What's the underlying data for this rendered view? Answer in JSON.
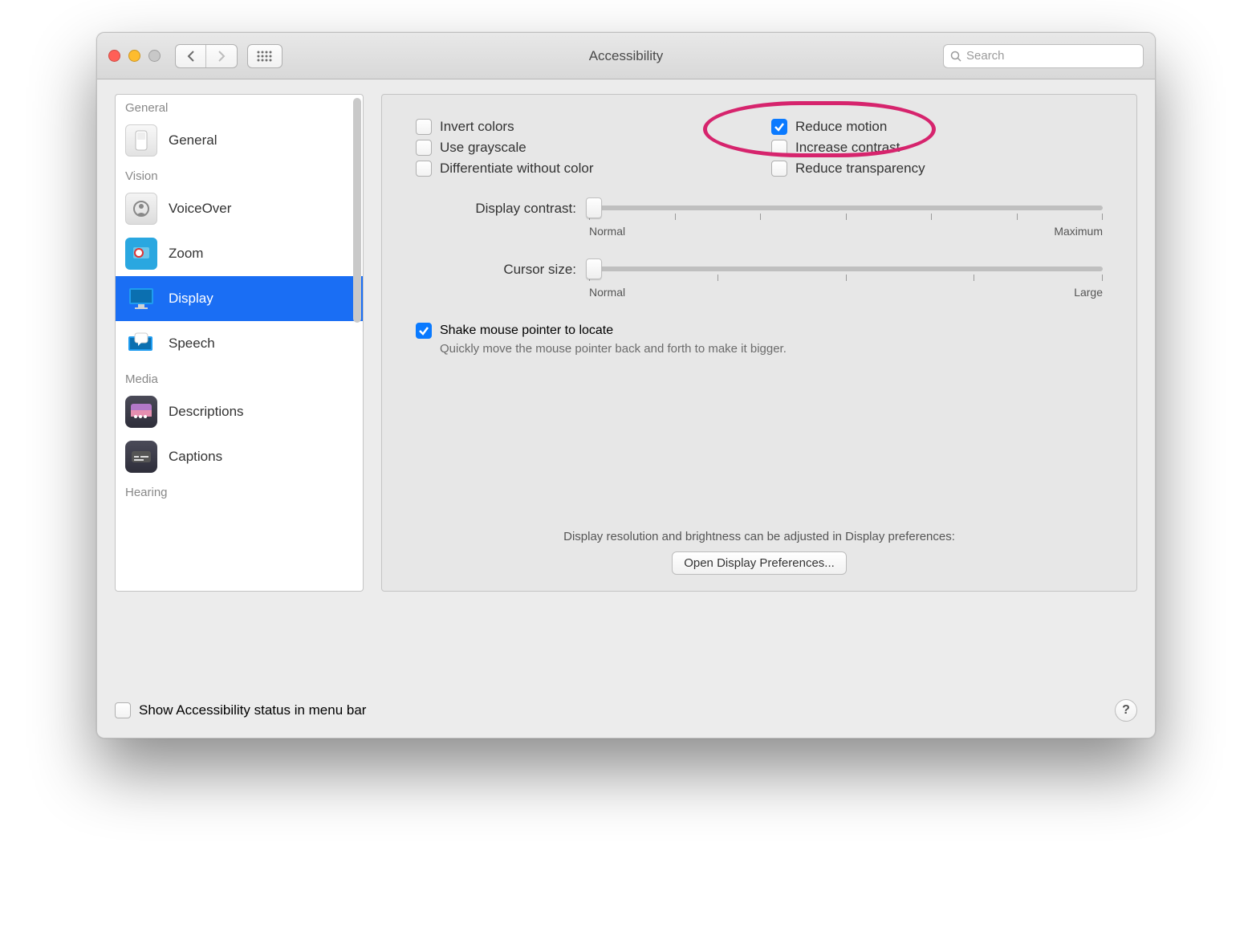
{
  "window": {
    "title": "Accessibility"
  },
  "search": {
    "placeholder": "Search"
  },
  "sidebar": {
    "sections": [
      {
        "header": "General",
        "items": [
          {
            "label": "General"
          }
        ]
      },
      {
        "header": "Vision",
        "items": [
          {
            "label": "VoiceOver"
          },
          {
            "label": "Zoom"
          },
          {
            "label": "Display"
          },
          {
            "label": "Speech"
          }
        ]
      },
      {
        "header": "Media",
        "items": [
          {
            "label": "Descriptions"
          },
          {
            "label": "Captions"
          }
        ]
      },
      {
        "header": "Hearing",
        "items": []
      }
    ]
  },
  "checks": {
    "invert_colors": {
      "label": "Invert colors",
      "checked": false
    },
    "reduce_motion": {
      "label": "Reduce motion",
      "checked": true
    },
    "use_grayscale": {
      "label": "Use grayscale",
      "checked": false
    },
    "increase_contrast": {
      "label": "Increase contrast",
      "checked": false
    },
    "diff_no_color": {
      "label": "Differentiate without color",
      "checked": false
    },
    "reduce_transp": {
      "label": "Reduce transparency",
      "checked": false
    }
  },
  "sliders": {
    "contrast": {
      "label": "Display contrast:",
      "min_label": "Normal",
      "max_label": "Maximum"
    },
    "cursor": {
      "label": "Cursor size:",
      "min_label": "Normal",
      "max_label": "Large"
    }
  },
  "shake": {
    "label": "Shake mouse pointer to locate",
    "hint": "Quickly move the mouse pointer back and forth to make it bigger.",
    "checked": true
  },
  "bottom": {
    "note": "Display resolution and brightness can be adjusted in Display preferences:",
    "button": "Open Display Preferences..."
  },
  "footer": {
    "menubar_label": "Show Accessibility status in menu bar",
    "menubar_checked": false,
    "help": "?"
  }
}
